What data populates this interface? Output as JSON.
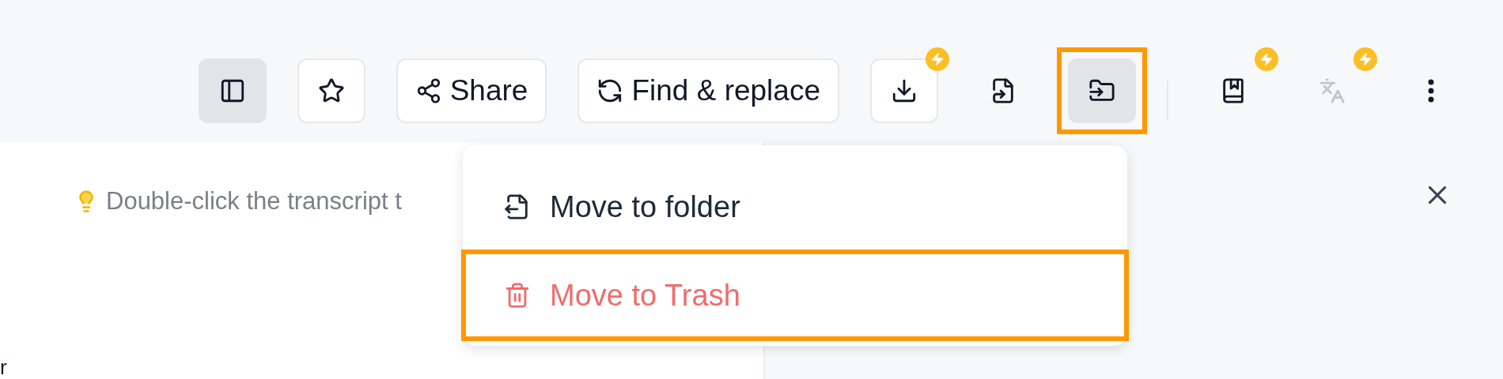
{
  "toolbar": [
    {
      "kind": "icon",
      "selected": true
    },
    {
      "kind": "outlined",
      "selected": false
    },
    {
      "kind": "outlined",
      "label": "Share",
      "selected": false
    },
    {
      "kind": "outlined",
      "label": "Find & replace",
      "selected": false
    },
    {
      "kind": "outlined",
      "selected": false,
      "badge": true
    },
    {
      "kind": "icon",
      "selected": false
    },
    {
      "kind": "icon",
      "selected": true,
      "highlighted": true
    },
    {
      "kind": "divider"
    },
    {
      "kind": "icon",
      "selected": false,
      "badge": true
    },
    {
      "kind": "icon",
      "selected": false,
      "badge": true,
      "disabled": true
    },
    {
      "kind": "icon",
      "selected": false
    }
  ],
  "hint": "Double-click the transcript t",
  "cut_text": "r",
  "menu": [
    {
      "label": "Move to folder",
      "danger": false,
      "highlighted": false
    },
    {
      "label": "Move to Trash",
      "danger": true,
      "highlighted": true
    }
  ]
}
